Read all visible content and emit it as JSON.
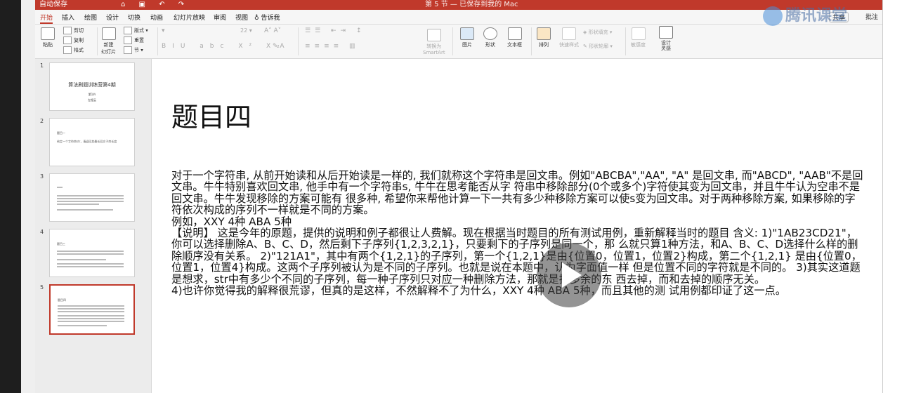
{
  "titlebar": {
    "autosave": "自动保存",
    "title": "第 5 节 — 已保存到我的 Mac"
  },
  "menu": [
    "开始",
    "插入",
    "绘图",
    "设计",
    "切换",
    "动画",
    "幻灯片放映",
    "审阅",
    "视图",
    "告诉我"
  ],
  "share": "共享",
  "comment": "批注",
  "ribbon": {
    "paste": "粘贴",
    "cut": "剪切",
    "copy": "复制",
    "format": "格式",
    "new_slide": "新建\n幻灯片",
    "layout": "版式",
    "reset": "重置",
    "section": "节",
    "font_size": "22",
    "convert": "转换为\nSmartArt",
    "picture": "图片",
    "shape": "形状",
    "textbox": "文本框",
    "arrange": "排列",
    "quick_style": "快速样式",
    "shape_fill": "形状填充",
    "shape_outline": "形状轮廓",
    "sensitivity": "敏感度",
    "designer": "设计\n灵感"
  },
  "watermark": "腾讯课堂",
  "thumbnails": [
    {
      "num": "1",
      "title": "算法刷题训练营第4期",
      "sub1": "第1节",
      "sub2": "左程云"
    },
    {
      "num": "2",
      "title": "题目一",
      "sub1": "给定一个字符串str，请返回其最长回文子串长度",
      "sub2": ""
    },
    {
      "num": "3",
      "title": "",
      "sub1": "",
      "sub2": ""
    },
    {
      "num": "4",
      "title": "题目三",
      "sub1": "",
      "sub2": ""
    },
    {
      "num": "5",
      "title": "题目四",
      "sub1": "",
      "sub2": ""
    }
  ],
  "slide": {
    "title": "题目四",
    "body": [
      "对于一个字符串, 从前开始读和从后开始读是一样的, 我们就称这个字符串是回文串。例如\"ABCBA\",\"AA\", \"A\" 是回文串, 而\"ABCD\", \"AAB\"不是回文串。牛牛特别喜欢回文串, 他手中有一个字符串s, 牛牛在思考能否从字 符串中移除部分(0个或多个)字符使其变为回文串，并且牛牛认为空串不是回文串。牛牛发现移除的方案可能有 很多种, 希望你来帮他计算一下一共有多少种移除方案可以使s变为回文串。对于两种移除方案, 如果移除的字 符依次构成的序列不一样就是不同的方案。",
      "例如，XXY 4种 ABA 5种",
      "【说明】 这是今年的原题，提供的说明和例子都很让人费解。现在根据当时题目的所有测试用例，重新解释当时的题目 含义: 1)\"1AB23CD21\"，你可以选择删除A、B、C、D，然后剩下子序列{1,2,3,2,1}，只要剩下的子序列是同一个，那 么就只算1种方法，和A、B、C、D选择什么样的删除顺序没有关系。 2)\"121A1\"，其中有两个{1,2,1}的子序列，第一个{1,2,1}是由{位置0，位置1，位置2}构成，第二个{1,2,1} 是由{位置0，位置1，位置4}构成。这两个子序列被认为是不同的子序列。也就是说在本题中，认为字面值一样 但是位置不同的字符就是不同的。 3)其实这道题是想求，str中有多少个不同的子序列，每一种子序列只对应一种删除方法，那就是把多余的东 西去掉，而和去掉的顺序无关。",
      "4)也许你觉得我的解释很荒谬，但真的是这样，不然解释不了为什么，XXY 4种 ABA 5种，而且其他的测 试用例都印证了这一点。"
    ]
  },
  "colors": {
    "accent": "#c0392b",
    "ribbon_bg": "#f6f6f6",
    "panel_bg": "#ececec"
  }
}
